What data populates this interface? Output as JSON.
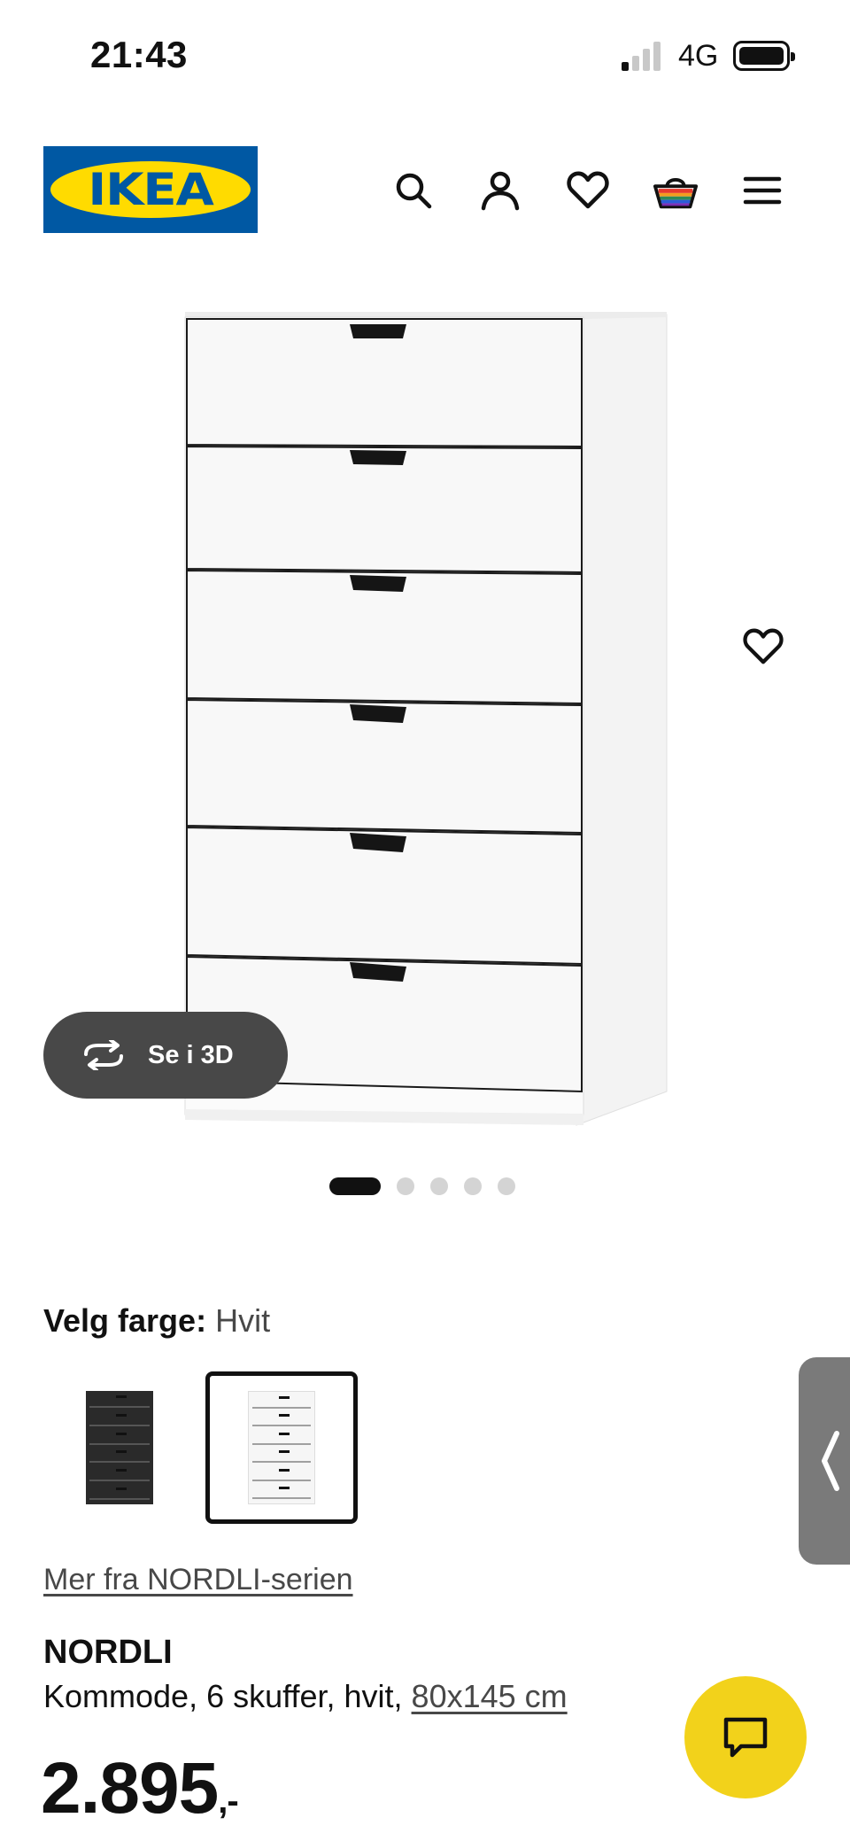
{
  "status_bar": {
    "time": "21:43",
    "network": "4G"
  },
  "header": {
    "logo_text": "IKEA",
    "icons": [
      "search-icon",
      "account-icon",
      "heart-icon",
      "basket-icon",
      "menu-icon"
    ]
  },
  "hero": {
    "view_3d_label": "Se i 3D",
    "carousel": {
      "total": 5,
      "active": 1
    }
  },
  "color": {
    "label": "Velg farge:",
    "value": "Hvit",
    "options": [
      "Svart",
      "Hvit"
    ],
    "selected": "Hvit"
  },
  "series_link": "Mer fra NORDLI-serien",
  "product": {
    "name": "NORDLI",
    "description": "Kommode, 6 skuffer, hvit,",
    "dimensions": "80x145 cm",
    "price": "2.895",
    "price_suffix": ",-"
  },
  "colors": {
    "ikea_blue": "#0058a3",
    "ikea_yellow": "#ffdb00",
    "chat_button": "#f2d21b",
    "view3d_bg": "#484848"
  }
}
